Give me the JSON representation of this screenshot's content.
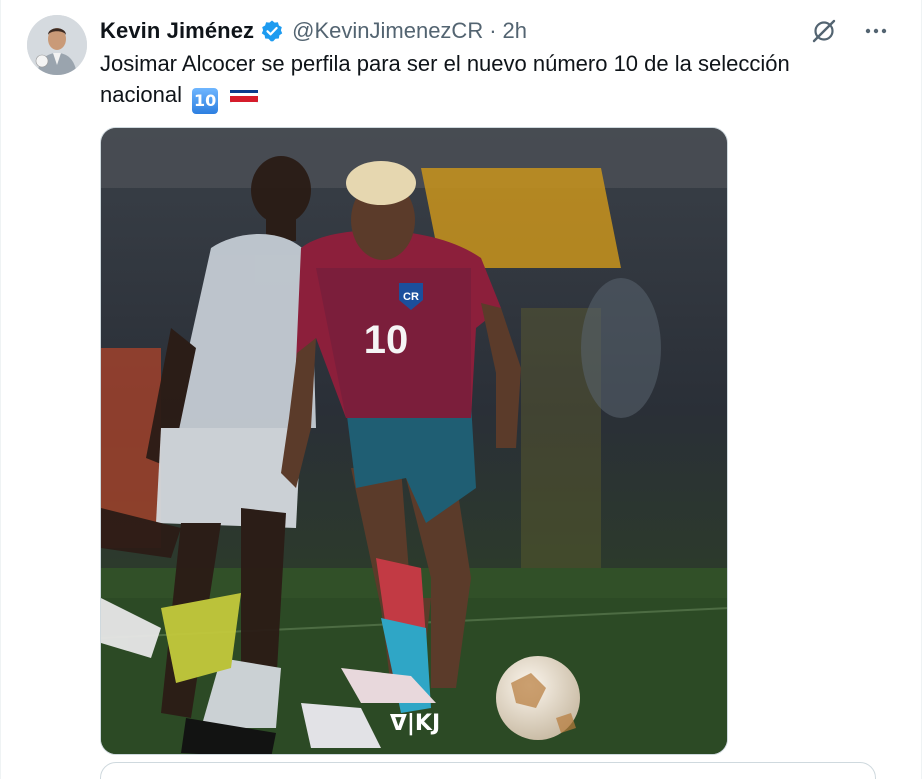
{
  "tweet": {
    "display_name": "Kevin Jiménez",
    "handle": "@KevinJimenezCR",
    "separator": "·",
    "time": "2h",
    "text": "Josimar Alcocer se perfila para ser el nuevo número 10 de la selección nacional",
    "emoji_number": "10",
    "flag": "costa-rica-flag"
  },
  "media": {
    "jersey_number": "10",
    "crest_text": "CR",
    "watermark": "ᐁ|KJ"
  },
  "icons": {
    "verified": "verified-badge-icon",
    "grok": "grok-icon",
    "more": "more-options-icon"
  },
  "colors": {
    "text": "#0f1419",
    "secondary": "#536471",
    "verified": "#1d9bf0",
    "border": "#cfd9de"
  }
}
